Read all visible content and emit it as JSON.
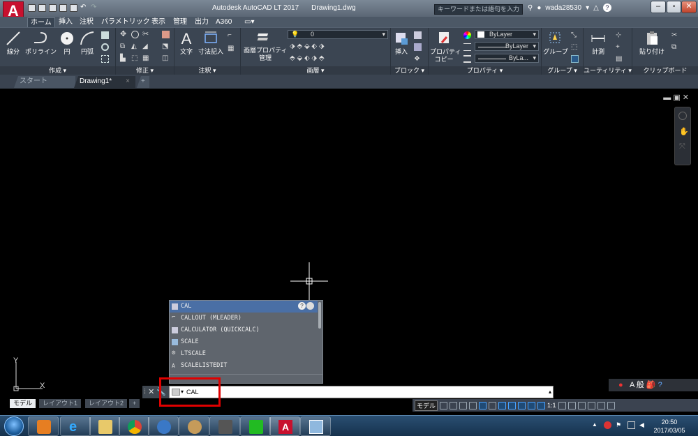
{
  "window": {
    "title": "Autodesk AutoCAD LT 2017",
    "document": "Drawing1.dwg",
    "logo": "A",
    "logo_sub": "LT",
    "search_placeholder": "キーワードまたは語句を入力",
    "user": "wada28530"
  },
  "ribbon_tabs": [
    "ホーム",
    "挿入",
    "注釈",
    "パラメトリック",
    "表示",
    "管理",
    "出力",
    "A360"
  ],
  "panels": {
    "draw": {
      "title": "作成 ▾",
      "line": "線分",
      "polyline": "ポリライン",
      "circle": "円",
      "arc": "円弧"
    },
    "modify": {
      "title": "修正 ▾"
    },
    "annotation": {
      "title": "注釈 ▾",
      "text": "文字",
      "dimension": "寸法記入"
    },
    "layers": {
      "title": "画層 ▾",
      "layer_props_1": "画層プロパティ",
      "layer_props_2": "管理",
      "current_layer": "0"
    },
    "block": {
      "title": "ブロック ▾",
      "insert": "挿入"
    },
    "properties": {
      "title": "プロパティ ▾",
      "match_1": "プロパティ",
      "match_2": "コピー",
      "color": "ByLayer",
      "linetype": "ByLayer",
      "lineweight": "ByLa..."
    },
    "groups": {
      "title": "グループ ▾",
      "group": "グループ"
    },
    "utilities": {
      "title": "ユーティリティ ▾",
      "measure": "計測"
    },
    "clipboard": {
      "title": "クリップボード",
      "paste": "貼り付け"
    }
  },
  "file_tabs": [
    "スタート",
    "Drawing1*"
  ],
  "autocomplete": [
    "CAL",
    "CALLOUT (MLEADER)",
    "CALCULATOR (QUICKCALC)",
    "SCALE",
    "LTSCALE",
    "SCALELISTEDIT"
  ],
  "command_line": {
    "value": "CAL"
  },
  "ucs": {
    "x": "X",
    "y": "Y"
  },
  "layout_tabs": [
    "モデル",
    "レイアウト1",
    "レイアウト2"
  ],
  "status": {
    "model": "モデル",
    "scale": "1:1"
  },
  "ime": {
    "mode": "A 般"
  },
  "clock": {
    "time": "20:50",
    "date": "2017/03/05"
  }
}
